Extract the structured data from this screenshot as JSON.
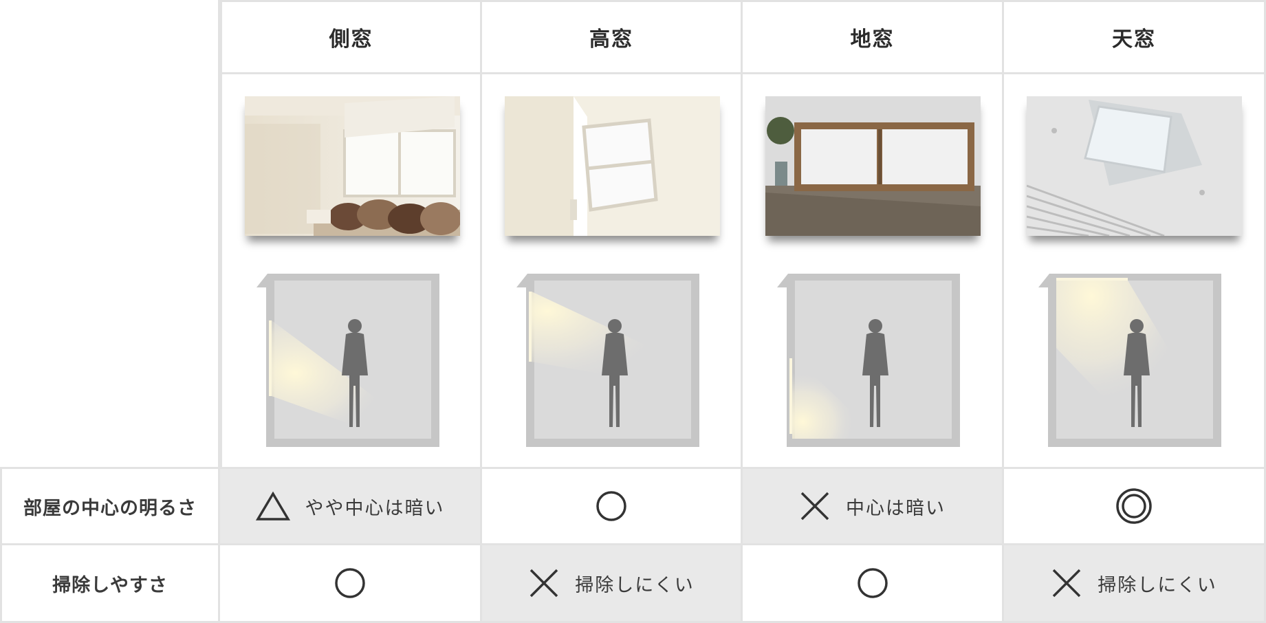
{
  "columns": [
    {
      "key": "side",
      "label": "側窓",
      "photo": "bedroom-with-side-window-photo",
      "diagram_window": "side"
    },
    {
      "key": "high",
      "label": "高窓",
      "photo": "high-window-photo",
      "diagram_window": "high"
    },
    {
      "key": "low",
      "label": "地窓",
      "photo": "low-floor-window-photo",
      "diagram_window": "low"
    },
    {
      "key": "sky",
      "label": "天窓",
      "photo": "skylight-photo",
      "diagram_window": "roof"
    }
  ],
  "rows": [
    {
      "label": "部屋の中心の明るさ",
      "values": [
        {
          "mark": "triangle",
          "text": "やや中心は暗い",
          "shaded": true
        },
        {
          "mark": "circle",
          "text": "",
          "shaded": false
        },
        {
          "mark": "cross",
          "text": "中心は暗い",
          "shaded": true
        },
        {
          "mark": "double-circle",
          "text": "",
          "shaded": false
        }
      ]
    },
    {
      "label": "掃除しやすさ",
      "values": [
        {
          "mark": "circle",
          "text": "",
          "shaded": false
        },
        {
          "mark": "cross",
          "text": "掃除しにくい",
          "shaded": true
        },
        {
          "mark": "circle",
          "text": "",
          "shaded": false
        },
        {
          "mark": "cross",
          "text": "掃除しにくい",
          "shaded": true
        }
      ]
    }
  ],
  "colors": {
    "grid": "#e2e2e2",
    "shade": "#e9e9e9",
    "wall": "#c6c6c6",
    "room": "#dadada",
    "light": "#f7f1d4"
  }
}
